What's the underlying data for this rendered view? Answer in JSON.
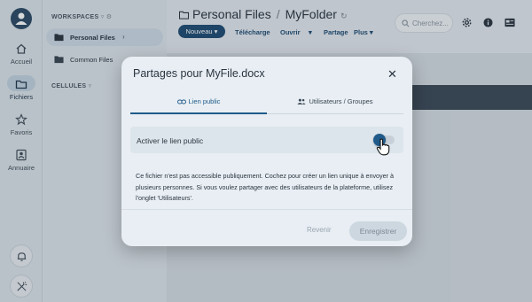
{
  "rail": {
    "items": [
      {
        "label": "Accueil",
        "icon": "home-icon"
      },
      {
        "label": "Fichiers",
        "icon": "folder-icon",
        "active": true
      },
      {
        "label": "Favoris",
        "icon": "star-icon"
      },
      {
        "label": "Annuaire",
        "icon": "contacts-icon"
      }
    ]
  },
  "sidebar": {
    "workspaces_heading": "WORKSPACES",
    "workspaces": [
      {
        "label": "Personal Files",
        "active": true
      },
      {
        "label": "Common Files"
      }
    ],
    "cells_heading": "CELLULES"
  },
  "header": {
    "breadcrumb": [
      "Personal Files",
      "MyFolder"
    ],
    "search_placeholder": "Cherchez..."
  },
  "toolbar": {
    "new_label": "Nouveau",
    "download_label": "Télécharge",
    "open_label": "Ouvrir",
    "share_label": "Partage",
    "more_label": "Plus"
  },
  "dialog": {
    "title": "Partages pour MyFile.docx",
    "tabs": [
      {
        "label": "Lien public",
        "active": true
      },
      {
        "label": "Utilisateurs / Groupes"
      }
    ],
    "toggle_label": "Activer le lien public",
    "toggle_on": false,
    "help_text": "Ce fichier n'est pas accessible publiquement. Cochez pour créer un lien unique à envoyer à plusieurs personnes. Si vous voulez partager avec des utilisateurs de la plateforme, utilisez l'onglet 'Utilisateurs'.",
    "revert_label": "Revenir",
    "save_label": "Enregistrer"
  },
  "colors": {
    "accent": "#1f5a8a",
    "primary_button": "#1f4c73"
  }
}
